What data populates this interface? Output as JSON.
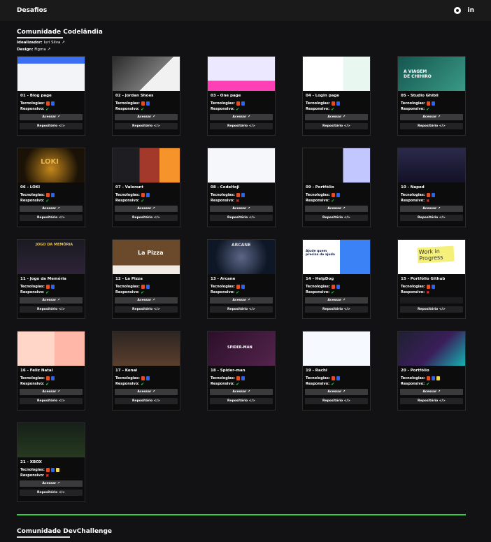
{
  "header": {
    "title": "Desafios",
    "icons": [
      "github-icon",
      "linkedin-icon"
    ],
    "linkedin_label": "in"
  },
  "community": {
    "title": "Comunidade Codelândia",
    "idealizer_label": "Idealizador:",
    "idealizer": "Iuri Silva",
    "design_label": "Design:",
    "design": "Figma"
  },
  "labels": {
    "tech": "Tecnologias:",
    "responsive": "Responsivo:",
    "access": "Acessar ↗",
    "repo": "Repositório </>"
  },
  "colors": {
    "accent": "#2bd33c",
    "ok": "#1fd142",
    "no": "#e53935",
    "html": "#e44d26",
    "css": "#2965f1",
    "js": "#f0db4f"
  },
  "cards": [
    {
      "title": "01 - Blog page",
      "techs": [
        "html",
        "css"
      ],
      "responsive": true
    },
    {
      "title": "02 - Jordan Shoes",
      "techs": [
        "html",
        "css"
      ],
      "responsive": true
    },
    {
      "title": "03 - One page",
      "techs": [
        "html",
        "css"
      ],
      "responsive": true
    },
    {
      "title": "04 - Login page",
      "techs": [
        "html",
        "css"
      ],
      "responsive": true
    },
    {
      "title": "05 - Studio Ghibli",
      "techs": [
        "html",
        "css"
      ],
      "responsive": true
    },
    {
      "title": "06 - LOKI",
      "techs": [
        "html",
        "css"
      ],
      "responsive": true
    },
    {
      "title": "07 - Valorant",
      "techs": [
        "html",
        "css"
      ],
      "responsive": true
    },
    {
      "title": "08 - CodeHoji",
      "techs": [
        "html",
        "css"
      ],
      "responsive": false
    },
    {
      "title": "09 - Portfólio",
      "techs": [
        "html",
        "css"
      ],
      "responsive": true
    },
    {
      "title": "10 - Naped",
      "techs": [
        "html",
        "css"
      ],
      "responsive": false
    },
    {
      "title": "11 - Jogo da Memória",
      "techs": [
        "html",
        "css"
      ],
      "responsive": true
    },
    {
      "title": "12 - La Pizza",
      "techs": [
        "html",
        "css"
      ],
      "responsive": true
    },
    {
      "title": "13 - Arcane",
      "techs": [
        "html",
        "css"
      ],
      "responsive": true
    },
    {
      "title": "14 - HelpDog",
      "techs": [
        "html",
        "css"
      ],
      "responsive": true
    },
    {
      "title": "15 - Portfólio Github",
      "techs": [
        "html",
        "css"
      ],
      "responsive": false,
      "no_access": true
    },
    {
      "title": "16 - Feliz Natal",
      "techs": [
        "html",
        "css"
      ],
      "responsive": true
    },
    {
      "title": "17 - Kenai",
      "techs": [
        "html",
        "css"
      ],
      "responsive": true
    },
    {
      "title": "18 - Spider-man",
      "techs": [
        "html",
        "css"
      ],
      "responsive": true
    },
    {
      "title": "19 - Rachi",
      "techs": [
        "html",
        "css"
      ],
      "responsive": true
    },
    {
      "title": "20 - Portfólio",
      "techs": [
        "html",
        "css",
        "js"
      ],
      "responsive": true
    },
    {
      "title": "21 - XBOX",
      "techs": [
        "html",
        "css",
        "js"
      ],
      "responsive": false
    }
  ],
  "thumb_text": {
    "loki": "LOKI",
    "ghibli": "A VIAGEM DE CHIHIRO",
    "pizza": "La Pizza",
    "arcane": "ARCANE",
    "helpdog": "Ajude quem precisa de ajuda",
    "progress": "Work in Progress",
    "spider": "SPIDER-MAN",
    "memory": "JOGO DA MEMÓRIA"
  },
  "community2": {
    "title": "Comunidade DevChallenge"
  }
}
